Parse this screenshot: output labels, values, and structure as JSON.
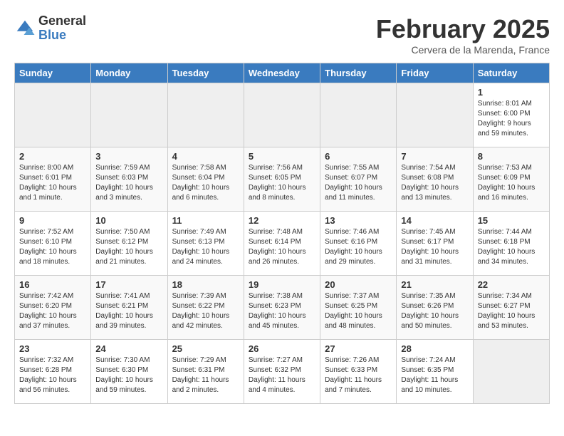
{
  "logo": {
    "general": "General",
    "blue": "Blue"
  },
  "title": "February 2025",
  "location": "Cervera de la Marenda, France",
  "days_of_week": [
    "Sunday",
    "Monday",
    "Tuesday",
    "Wednesday",
    "Thursday",
    "Friday",
    "Saturday"
  ],
  "weeks": [
    [
      {
        "day": "",
        "empty": true
      },
      {
        "day": "",
        "empty": true
      },
      {
        "day": "",
        "empty": true
      },
      {
        "day": "",
        "empty": true
      },
      {
        "day": "",
        "empty": true
      },
      {
        "day": "",
        "empty": true
      },
      {
        "day": "1",
        "sunrise": "Sunrise: 8:01 AM",
        "sunset": "Sunset: 6:00 PM",
        "daylight": "Daylight: 9 hours and 59 minutes."
      }
    ],
    [
      {
        "day": "2",
        "sunrise": "Sunrise: 8:00 AM",
        "sunset": "Sunset: 6:01 PM",
        "daylight": "Daylight: 10 hours and 1 minute."
      },
      {
        "day": "3",
        "sunrise": "Sunrise: 7:59 AM",
        "sunset": "Sunset: 6:03 PM",
        "daylight": "Daylight: 10 hours and 3 minutes."
      },
      {
        "day": "4",
        "sunrise": "Sunrise: 7:58 AM",
        "sunset": "Sunset: 6:04 PM",
        "daylight": "Daylight: 10 hours and 6 minutes."
      },
      {
        "day": "5",
        "sunrise": "Sunrise: 7:56 AM",
        "sunset": "Sunset: 6:05 PM",
        "daylight": "Daylight: 10 hours and 8 minutes."
      },
      {
        "day": "6",
        "sunrise": "Sunrise: 7:55 AM",
        "sunset": "Sunset: 6:07 PM",
        "daylight": "Daylight: 10 hours and 11 minutes."
      },
      {
        "day": "7",
        "sunrise": "Sunrise: 7:54 AM",
        "sunset": "Sunset: 6:08 PM",
        "daylight": "Daylight: 10 hours and 13 minutes."
      },
      {
        "day": "8",
        "sunrise": "Sunrise: 7:53 AM",
        "sunset": "Sunset: 6:09 PM",
        "daylight": "Daylight: 10 hours and 16 minutes."
      }
    ],
    [
      {
        "day": "9",
        "sunrise": "Sunrise: 7:52 AM",
        "sunset": "Sunset: 6:10 PM",
        "daylight": "Daylight: 10 hours and 18 minutes."
      },
      {
        "day": "10",
        "sunrise": "Sunrise: 7:50 AM",
        "sunset": "Sunset: 6:12 PM",
        "daylight": "Daylight: 10 hours and 21 minutes."
      },
      {
        "day": "11",
        "sunrise": "Sunrise: 7:49 AM",
        "sunset": "Sunset: 6:13 PM",
        "daylight": "Daylight: 10 hours and 24 minutes."
      },
      {
        "day": "12",
        "sunrise": "Sunrise: 7:48 AM",
        "sunset": "Sunset: 6:14 PM",
        "daylight": "Daylight: 10 hours and 26 minutes."
      },
      {
        "day": "13",
        "sunrise": "Sunrise: 7:46 AM",
        "sunset": "Sunset: 6:16 PM",
        "daylight": "Daylight: 10 hours and 29 minutes."
      },
      {
        "day": "14",
        "sunrise": "Sunrise: 7:45 AM",
        "sunset": "Sunset: 6:17 PM",
        "daylight": "Daylight: 10 hours and 31 minutes."
      },
      {
        "day": "15",
        "sunrise": "Sunrise: 7:44 AM",
        "sunset": "Sunset: 6:18 PM",
        "daylight": "Daylight: 10 hours and 34 minutes."
      }
    ],
    [
      {
        "day": "16",
        "sunrise": "Sunrise: 7:42 AM",
        "sunset": "Sunset: 6:20 PM",
        "daylight": "Daylight: 10 hours and 37 minutes."
      },
      {
        "day": "17",
        "sunrise": "Sunrise: 7:41 AM",
        "sunset": "Sunset: 6:21 PM",
        "daylight": "Daylight: 10 hours and 39 minutes."
      },
      {
        "day": "18",
        "sunrise": "Sunrise: 7:39 AM",
        "sunset": "Sunset: 6:22 PM",
        "daylight": "Daylight: 10 hours and 42 minutes."
      },
      {
        "day": "19",
        "sunrise": "Sunrise: 7:38 AM",
        "sunset": "Sunset: 6:23 PM",
        "daylight": "Daylight: 10 hours and 45 minutes."
      },
      {
        "day": "20",
        "sunrise": "Sunrise: 7:37 AM",
        "sunset": "Sunset: 6:25 PM",
        "daylight": "Daylight: 10 hours and 48 minutes."
      },
      {
        "day": "21",
        "sunrise": "Sunrise: 7:35 AM",
        "sunset": "Sunset: 6:26 PM",
        "daylight": "Daylight: 10 hours and 50 minutes."
      },
      {
        "day": "22",
        "sunrise": "Sunrise: 7:34 AM",
        "sunset": "Sunset: 6:27 PM",
        "daylight": "Daylight: 10 hours and 53 minutes."
      }
    ],
    [
      {
        "day": "23",
        "sunrise": "Sunrise: 7:32 AM",
        "sunset": "Sunset: 6:28 PM",
        "daylight": "Daylight: 10 hours and 56 minutes."
      },
      {
        "day": "24",
        "sunrise": "Sunrise: 7:30 AM",
        "sunset": "Sunset: 6:30 PM",
        "daylight": "Daylight: 10 hours and 59 minutes."
      },
      {
        "day": "25",
        "sunrise": "Sunrise: 7:29 AM",
        "sunset": "Sunset: 6:31 PM",
        "daylight": "Daylight: 11 hours and 2 minutes."
      },
      {
        "day": "26",
        "sunrise": "Sunrise: 7:27 AM",
        "sunset": "Sunset: 6:32 PM",
        "daylight": "Daylight: 11 hours and 4 minutes."
      },
      {
        "day": "27",
        "sunrise": "Sunrise: 7:26 AM",
        "sunset": "Sunset: 6:33 PM",
        "daylight": "Daylight: 11 hours and 7 minutes."
      },
      {
        "day": "28",
        "sunrise": "Sunrise: 7:24 AM",
        "sunset": "Sunset: 6:35 PM",
        "daylight": "Daylight: 11 hours and 10 minutes."
      },
      {
        "day": "",
        "empty": true
      }
    ]
  ]
}
